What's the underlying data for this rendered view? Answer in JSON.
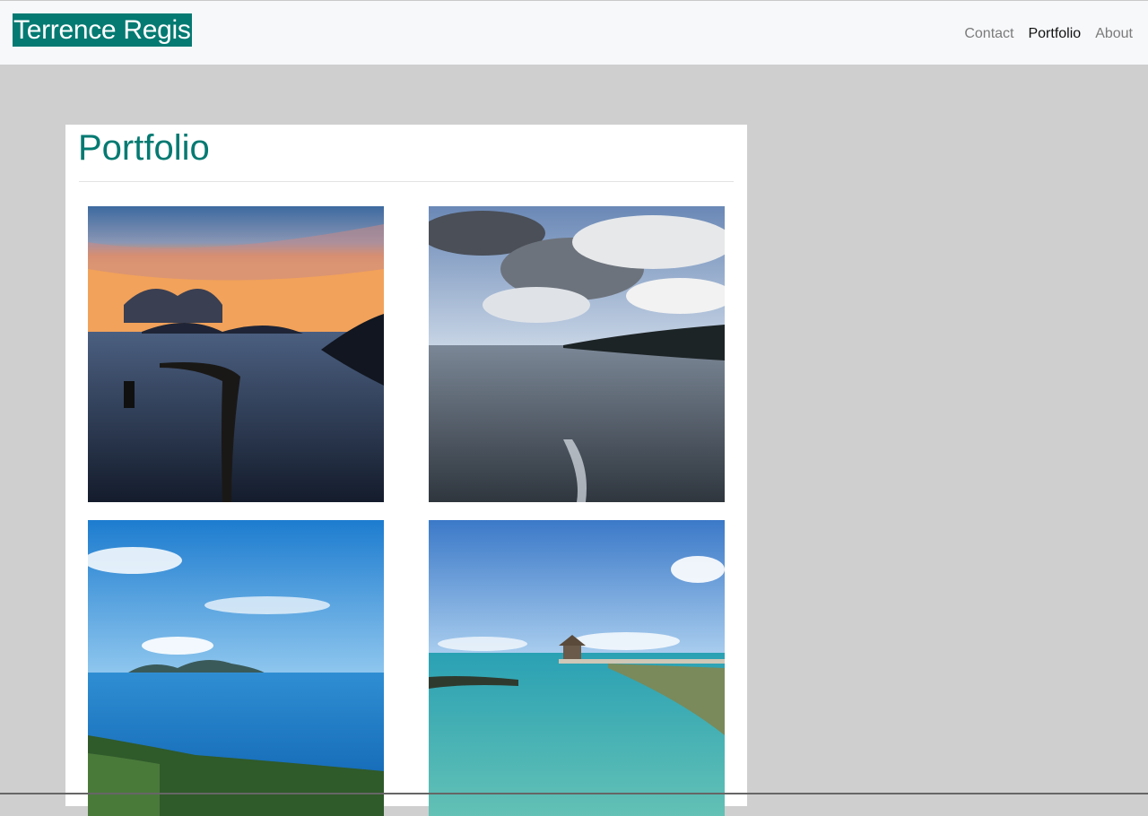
{
  "navbar": {
    "brand": "Terrence Regis",
    "links": [
      {
        "label": "Contact",
        "active": false
      },
      {
        "label": "Portfolio",
        "active": true
      },
      {
        "label": "About",
        "active": false
      }
    ]
  },
  "main": {
    "title": "Portfolio",
    "photos": [
      {
        "subject": "sunset over sea with breakwater"
      },
      {
        "subject": "cloudy sky over calm sea and coastline"
      },
      {
        "subject": "blue bay with island and village"
      },
      {
        "subject": "turquoise lagoon with pier and hut"
      }
    ]
  },
  "colors": {
    "accent": "#047a72",
    "page_background": "#cfcfcf",
    "navbar_background": "#f7f8fa"
  }
}
